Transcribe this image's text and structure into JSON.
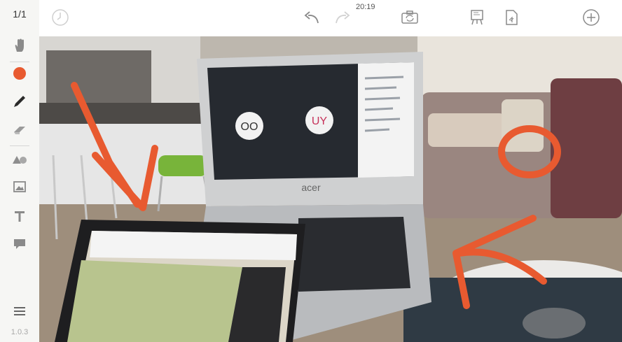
{
  "sidebar": {
    "page_counter": "1/1",
    "version": "1.0.3",
    "tools": [
      {
        "name": "hand-tool",
        "icon": "hand-icon"
      },
      {
        "name": "color-picker",
        "icon": "color-dot-icon",
        "color": "#e85a30"
      },
      {
        "name": "pen-tool",
        "icon": "pen-icon"
      },
      {
        "name": "eraser-tool",
        "icon": "eraser-icon"
      },
      {
        "name": "shapes-tool",
        "icon": "shapes-icon"
      },
      {
        "name": "image-tool",
        "icon": "image-icon"
      },
      {
        "name": "text-tool",
        "icon": "text-icon"
      },
      {
        "name": "comment-tool",
        "icon": "comment-icon"
      },
      {
        "name": "menu",
        "icon": "hamburger-icon"
      }
    ]
  },
  "topbar": {
    "time": "20:19",
    "buttons": [
      {
        "name": "history-button",
        "icon": "clock-icon"
      },
      {
        "name": "undo-button",
        "icon": "undo-icon"
      },
      {
        "name": "redo-button",
        "icon": "redo-icon"
      },
      {
        "name": "camera-switch-button",
        "icon": "camera-switch-icon"
      },
      {
        "name": "presentation-button",
        "icon": "easel-icon"
      },
      {
        "name": "export-button",
        "icon": "document-icon"
      },
      {
        "name": "add-page-button",
        "icon": "plus-circle-icon"
      }
    ]
  },
  "canvas": {
    "laptop_screen": {
      "left_circle_label": "OO",
      "right_circle_label": "UY"
    },
    "laptop_brand": "acer",
    "annotation_color": "#e85a30"
  }
}
